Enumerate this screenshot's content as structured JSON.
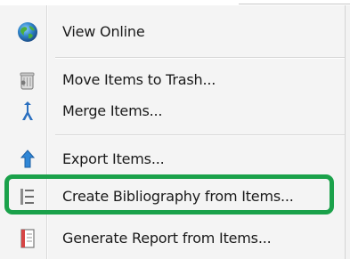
{
  "context_menu": {
    "items": [
      {
        "label": "View Online",
        "icon": "globe-icon"
      },
      {
        "label": "Move Items to Trash...",
        "icon": "trash-icon"
      },
      {
        "label": "Merge Items...",
        "icon": "merge-icon"
      },
      {
        "label": "Export Items...",
        "icon": "export-arrow-icon"
      },
      {
        "label": "Create Bibliography from Items...",
        "icon": "bibliography-list-icon"
      },
      {
        "label": "Generate Report from Items...",
        "icon": "report-icon"
      }
    ],
    "highlighted_item": "Create Bibliography from Items...",
    "highlight_color": "#1aa14a"
  }
}
